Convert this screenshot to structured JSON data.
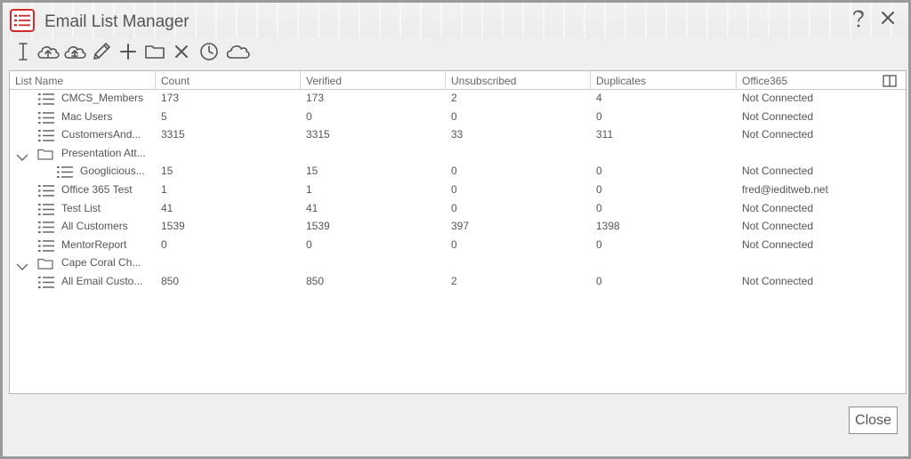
{
  "window": {
    "title": "Email List Manager",
    "help_icon": "help-icon",
    "close_icon": "close-icon",
    "accent_color": "#d12b2b"
  },
  "toolbar": {
    "icons": [
      "text-cursor-icon",
      "cloud-upload-icon",
      "cloud-download-icon",
      "pencil-icon",
      "plus-icon",
      "folder-icon",
      "delete-x-icon",
      "clock-icon",
      "cloud-icon"
    ]
  },
  "grid": {
    "columns": [
      "List Name",
      "Count",
      "Verified",
      "Unsubscribed",
      "Duplicates",
      "Office365"
    ],
    "rows": [
      {
        "type": "list",
        "level": 0,
        "name": "CMCS_Members",
        "count": "173",
        "verified": "173",
        "unsubscribed": "2",
        "duplicates": "4",
        "office365": "Not Connected"
      },
      {
        "type": "list",
        "level": 0,
        "name": "Mac Users",
        "count": "5",
        "verified": "0",
        "unsubscribed": "0",
        "duplicates": "0",
        "office365": "Not Connected"
      },
      {
        "type": "list",
        "level": 0,
        "name": "CustomersAnd...",
        "count": "3315",
        "verified": "3315",
        "unsubscribed": "33",
        "duplicates": "311",
        "office365": "Not Connected"
      },
      {
        "type": "folder",
        "level": 0,
        "name": "Presentation Att...",
        "count": "",
        "verified": "",
        "unsubscribed": "",
        "duplicates": "",
        "office365": ""
      },
      {
        "type": "list",
        "level": 1,
        "name": "Googlicious...",
        "count": "15",
        "verified": "15",
        "unsubscribed": "0",
        "duplicates": "0",
        "office365": "Not Connected"
      },
      {
        "type": "list",
        "level": 0,
        "name": "Office 365 Test",
        "count": "1",
        "verified": "1",
        "unsubscribed": "0",
        "duplicates": "0",
        "office365": "fred@ieditweb.net"
      },
      {
        "type": "list",
        "level": 0,
        "name": "Test List",
        "count": "41",
        "verified": "41",
        "unsubscribed": "0",
        "duplicates": "0",
        "office365": "Not Connected"
      },
      {
        "type": "list",
        "level": 0,
        "name": "All Customers",
        "count": "1539",
        "verified": "1539",
        "unsubscribed": "397",
        "duplicates": "1398",
        "office365": "Not Connected"
      },
      {
        "type": "list",
        "level": 0,
        "name": "MentorReport",
        "count": "0",
        "verified": "0",
        "unsubscribed": "0",
        "duplicates": "0",
        "office365": "Not Connected"
      },
      {
        "type": "folder",
        "level": 0,
        "name": "Cape Coral Ch...",
        "count": "",
        "verified": "",
        "unsubscribed": "",
        "duplicates": "",
        "office365": ""
      },
      {
        "type": "list",
        "level": 0,
        "name": "All Email Custo...",
        "count": "850",
        "verified": "850",
        "unsubscribed": "2",
        "duplicates": "0",
        "office365": "Not Connected"
      }
    ]
  },
  "footer": {
    "close_label": "Close"
  }
}
